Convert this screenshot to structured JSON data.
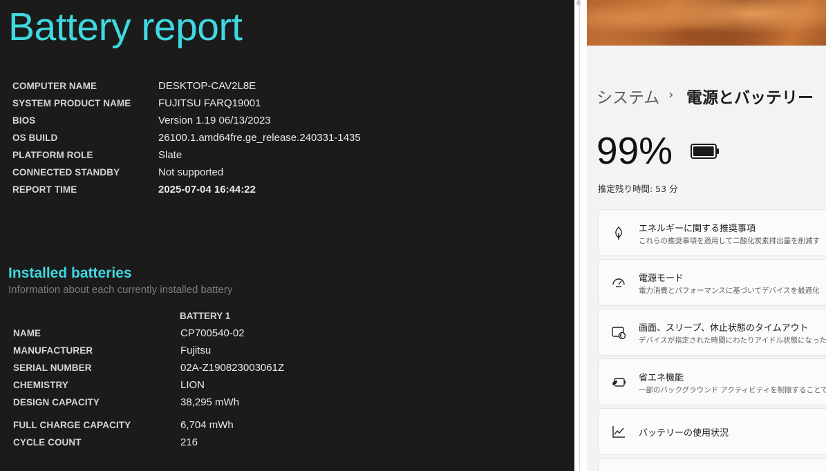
{
  "report": {
    "title": "Battery report",
    "system_info": [
      {
        "label": "COMPUTER NAME",
        "value": "DESKTOP-CAV2L8E"
      },
      {
        "label": "SYSTEM PRODUCT NAME",
        "value": "FUJITSU FARQ19001"
      },
      {
        "label": "BIOS",
        "value": "Version 1.19 06/13/2023"
      },
      {
        "label": "OS BUILD",
        "value": "26100.1.amd64fre.ge_release.240331-1435"
      },
      {
        "label": "PLATFORM ROLE",
        "value": "Slate"
      },
      {
        "label": "CONNECTED STANDBY",
        "value": "Not supported"
      },
      {
        "label": "REPORT TIME",
        "value": "2025-07-04  16:44:22"
      }
    ],
    "installed_batteries": {
      "title": "Installed batteries",
      "subtitle": "Information about each currently installed battery",
      "column_header": "BATTERY 1",
      "rows": [
        {
          "label": "NAME",
          "value": "CP700540-02"
        },
        {
          "label": "MANUFACTURER",
          "value": "Fujitsu"
        },
        {
          "label": "SERIAL NUMBER",
          "value": "02A-Z190823003061Z"
        },
        {
          "label": "CHEMISTRY",
          "value": "LION"
        },
        {
          "label": "DESIGN CAPACITY",
          "value": "38,295 mWh"
        },
        {
          "label": "FULL CHARGE CAPACITY",
          "value": "6,704 mWh"
        },
        {
          "label": "CYCLE COUNT",
          "value": "216"
        }
      ]
    }
  },
  "settings": {
    "breadcrumb_parent": "システム",
    "breadcrumb_separator": "›",
    "breadcrumb_current": "電源とバッテリー",
    "battery_percent": "99%",
    "battery_level": 0.99,
    "remaining_label": "推定残り時間: 53 分",
    "cards": [
      {
        "icon": "leaf-icon",
        "title": "エネルギーに関する推奨事項",
        "subtitle": "これらの推奨事項を適用して二酸化炭素排出量を削減す"
      },
      {
        "icon": "power-mode-gauge-icon",
        "title": "電源モード",
        "subtitle": "電力消費とパフォーマンスに基づいてデバイスを最適化"
      },
      {
        "icon": "screen-sleep-icon",
        "title": "画面、スリープ、休止状態のタイムアウト",
        "subtitle": "デバイスが指定された時間にわたりアイドル状態になった場"
      },
      {
        "icon": "battery-saver-icon",
        "title": "省エネ機能",
        "subtitle": "一部のバックグラウンド アクティビティを制限することで、電力"
      },
      {
        "icon": "chart-line-icon",
        "title": "バッテリーの使用状況",
        "subtitle": ""
      }
    ],
    "colors": {
      "accent": "#3fd8e0",
      "report_bg": "#1b1b1b",
      "settings_bg": "#f3f3f3"
    }
  }
}
